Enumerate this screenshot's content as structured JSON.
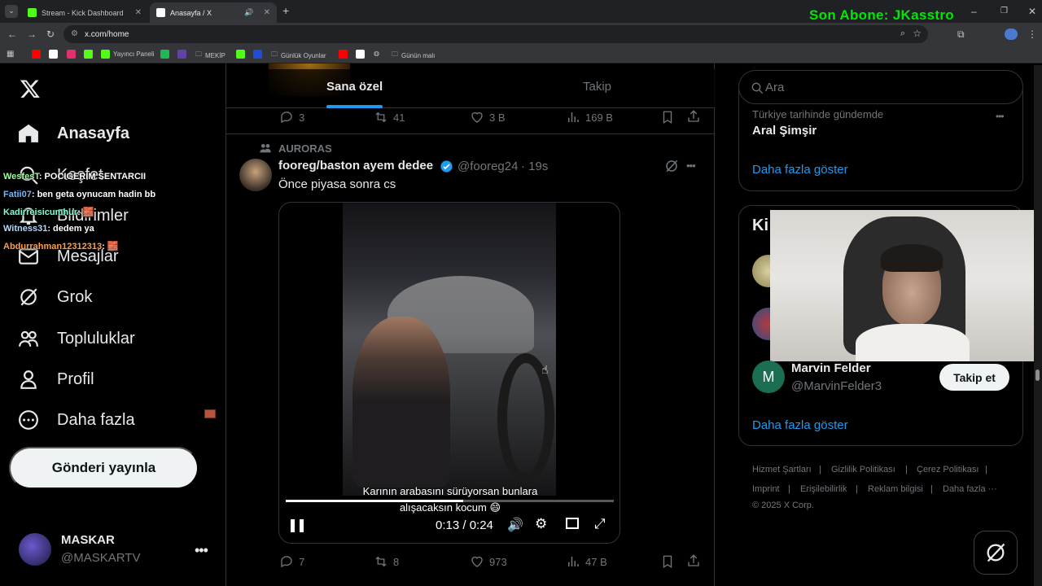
{
  "browser": {
    "tabs": [
      {
        "title": "Stream - Kick Dashboard",
        "favicon_color": "#53fc18"
      },
      {
        "title": "Anasayfa / X",
        "favicon_color": "#ffffff"
      }
    ],
    "url": "x.com/home",
    "new_tab": "+",
    "bookmarks": [
      {
        "label": "",
        "color": "#ff0000"
      },
      {
        "label": "",
        "color": "#ffffff"
      },
      {
        "label": "",
        "color": "#e1306c"
      },
      {
        "label": "",
        "color": "#53fc18"
      },
      {
        "label": "Yayıncı Paneli",
        "color": "#53fc18"
      },
      {
        "label": "",
        "color": "#1db954"
      },
      {
        "label": "",
        "color": "#6441a5"
      },
      {
        "label": "MEKİP",
        "color": "#9aa0a6"
      },
      {
        "label": "",
        "color": "#53fc18"
      },
      {
        "label": "",
        "color": "#1d4ed8"
      },
      {
        "label": "Günlük Oyunlar",
        "color": "#9aa0a6"
      },
      {
        "label": "",
        "color": "#ff0000"
      },
      {
        "label": "",
        "color": "#ffffff"
      },
      {
        "label": "",
        "color": "#9aa0a6"
      },
      {
        "label": "Günün malı",
        "color": "#9aa0a6"
      }
    ]
  },
  "overlay": {
    "son_abone": "Son Abone: JKasstro",
    "chat": [
      {
        "user": "WesfesT",
        "msg": ": POCIGERIM SENTARCII",
        "color": "#9cff9c"
      },
      {
        "user": "Fatii07",
        "msg": ": ben geta oynucam hadin bb",
        "color": "#6fb7ff"
      },
      {
        "user": "Kadirreisicumhur",
        "msg": ": 🧱",
        "color": "#7fffd4"
      },
      {
        "user": "Witness31",
        "msg": ": dedem ya",
        "color": "#b4d7ff"
      },
      {
        "user": "Abdurrahman12312313",
        "msg": ": 🧱",
        "color": "#ff9f43"
      }
    ]
  },
  "nav": {
    "items": [
      {
        "label": "Anasayfa",
        "icon": "home-icon",
        "bold": true
      },
      {
        "label": "Keşfet",
        "icon": "search-icon"
      },
      {
        "label": "Bildirimler",
        "icon": "bell-icon"
      },
      {
        "label": "Mesajlar",
        "icon": "mail-icon"
      },
      {
        "label": "Grok",
        "icon": "grok-icon"
      },
      {
        "label": "Topluluklar",
        "icon": "people-icon"
      },
      {
        "label": "Profil",
        "icon": "person-icon"
      },
      {
        "label": "Daha fazla",
        "icon": "more-circle-icon"
      }
    ],
    "post_button": "Gönderi yayınla",
    "profile": {
      "name": "MASKAR",
      "handle": "@MASKARTV"
    }
  },
  "feed": {
    "tabs": [
      "Sana özel",
      "Takip"
    ],
    "prev_metrics": {
      "replies": "3",
      "reposts": "41",
      "likes": "3 B",
      "views": "169 B"
    },
    "tweet": {
      "community": "AURORAS",
      "name": "fooreg/baston ayem dedee",
      "handle": "@fooreg24",
      "time": "· 19s",
      "text": "Önce piyasa sonra cs",
      "video": {
        "subtitle_1": "Karının arabasını sürüyorsan bunlara",
        "subtitle_2": "alışacaksın kocum 😄",
        "time": "0:13 / 0:24",
        "progress": 0.54
      },
      "metrics": {
        "replies": "7",
        "reposts": "8",
        "likes": "973",
        "views": "47 B"
      }
    }
  },
  "right": {
    "search_placeholder": "Ara",
    "trend": {
      "context": "Türkiye tarihinde gündemde",
      "title": "Aral Şimşir"
    },
    "show_more": "Daha fazla göster",
    "who_to_follow_title": "Ki",
    "suggestion": {
      "name": "Marvin Felder",
      "handle": "@MarvinFelder3",
      "initial": "M",
      "button": "Takip et"
    },
    "footer": [
      "Hizmet Şartları",
      "|",
      "Gizlilik Politikası",
      "|",
      "Çerez Politikası",
      "|",
      "Imprint",
      "|",
      "Erişilebilirlik",
      "|",
      "Reklam bilgisi",
      "|",
      "Daha fazla ···",
      "© 2025 X Corp."
    ]
  }
}
